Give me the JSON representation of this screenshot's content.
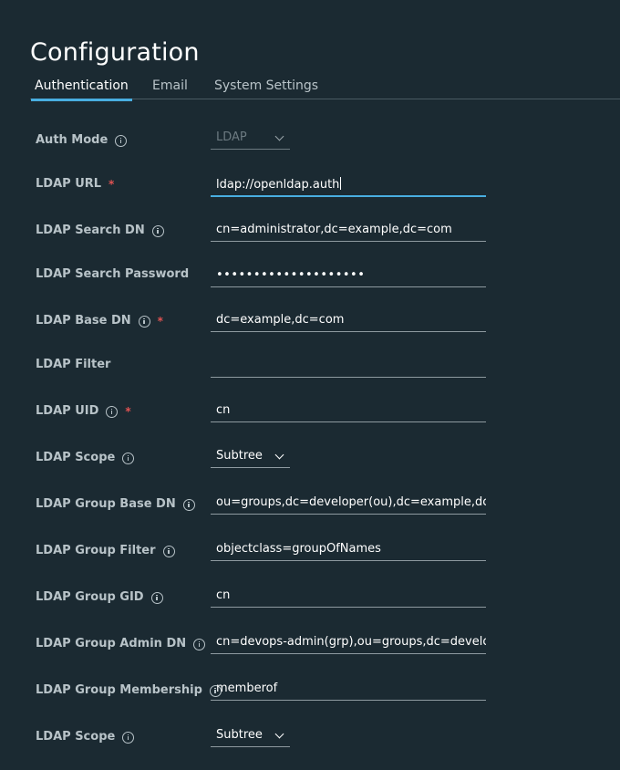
{
  "page": {
    "title": "Configuration"
  },
  "tabs": [
    {
      "label": "Authentication"
    },
    {
      "label": "Email"
    },
    {
      "label": "System Settings"
    }
  ],
  "fields": {
    "auth_mode": {
      "label": "Auth Mode",
      "value": "LDAP"
    },
    "ldap_url": {
      "label": "LDAP URL",
      "value": "ldap://openldap.auth",
      "required": "*"
    },
    "ldap_search_dn": {
      "label": "LDAP Search DN",
      "value": "cn=administrator,dc=example,dc=com"
    },
    "ldap_search_password": {
      "label": "LDAP Search Password",
      "value": "••••••••••••••••••••"
    },
    "ldap_base_dn": {
      "label": "LDAP Base DN",
      "value": "dc=example,dc=com",
      "required": "*"
    },
    "ldap_filter": {
      "label": "LDAP Filter",
      "value": ""
    },
    "ldap_uid": {
      "label": "LDAP UID",
      "value": "cn",
      "required": "*"
    },
    "ldap_scope": {
      "label": "LDAP Scope",
      "value": "Subtree"
    },
    "ldap_group_base_dn": {
      "label": "LDAP Group Base DN",
      "value": "ou=groups,dc=developer(ou),dc=example,dc=com"
    },
    "ldap_group_filter": {
      "label": "LDAP Group Filter",
      "value": "objectclass=groupOfNames"
    },
    "ldap_group_gid": {
      "label": "LDAP Group GID",
      "value": "cn"
    },
    "ldap_group_admin_dn": {
      "label": "LDAP Group Admin DN",
      "value": "cn=devops-admin(grp),ou=groups,dc=developer(ou),dc=example,dc=com"
    },
    "ldap_group_membership": {
      "label": "LDAP Group Membership",
      "value": "memberof"
    },
    "ldap_group_scope": {
      "label": "LDAP Scope",
      "value": "Subtree"
    }
  },
  "colors": {
    "background": "#1b2a32",
    "accent": "#49aee0",
    "required": "#e05252",
    "label": "#b8c3c8"
  }
}
